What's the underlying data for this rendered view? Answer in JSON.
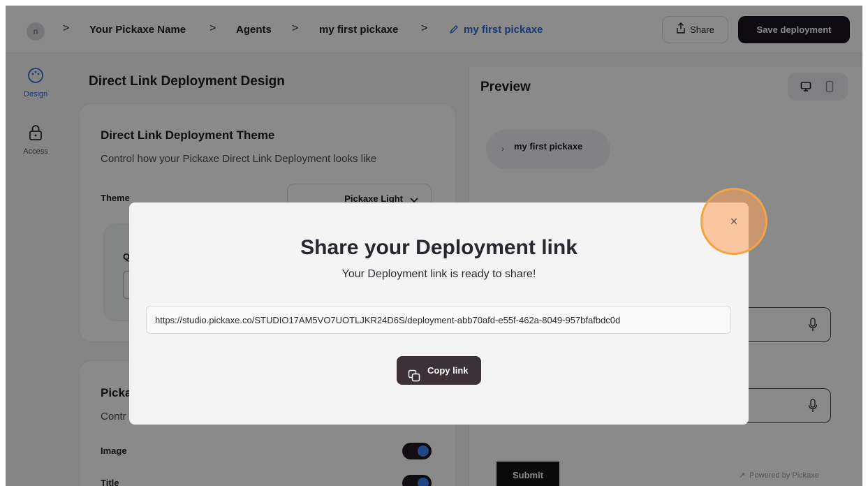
{
  "header": {
    "avatar_initial": "n",
    "breadcrumbs": [
      "Your Pickaxe Name",
      "Agents",
      "my first pickaxe",
      "my first pickaxe"
    ],
    "separator": ">",
    "share_label": "Share",
    "save_label": "Save deployment"
  },
  "rail": {
    "items": [
      {
        "label": "Design",
        "icon": "palette-icon"
      },
      {
        "label": "Access",
        "icon": "lock-icon"
      }
    ]
  },
  "design": {
    "section_title": "Direct Link Deployment Design",
    "theme_card": {
      "title": "Direct Link Deployment Theme",
      "description": "Control how your Pickaxe Direct Link Deployment looks like",
      "theme_label": "Theme",
      "theme_value": "Pickaxe Light",
      "partial_q": "Q"
    },
    "pickaxe_card": {
      "title_partial": "Picka",
      "desc_partial": "Contr",
      "image_label": "Image",
      "title_label": "Title"
    }
  },
  "preview": {
    "title": "Preview",
    "chip_label": "my first pickaxe",
    "submit_label": "Submit",
    "powered_by": "Powered by Pickaxe"
  },
  "modal": {
    "title": "Share your Deployment link",
    "subtitle": "Your Deployment link is ready to share!",
    "link": "https://studio.pickaxe.co/STUDIO17AM5VO7UOTLJKR24D6S/deployment-abb70afd-e55f-462a-8049-957bfafbdc0d",
    "copy_label": "Copy link",
    "close_symbol": "×"
  },
  "colors": {
    "accent": "#2c6bd4",
    "dark_button": "#19161d",
    "highlight": "#f2a444"
  }
}
